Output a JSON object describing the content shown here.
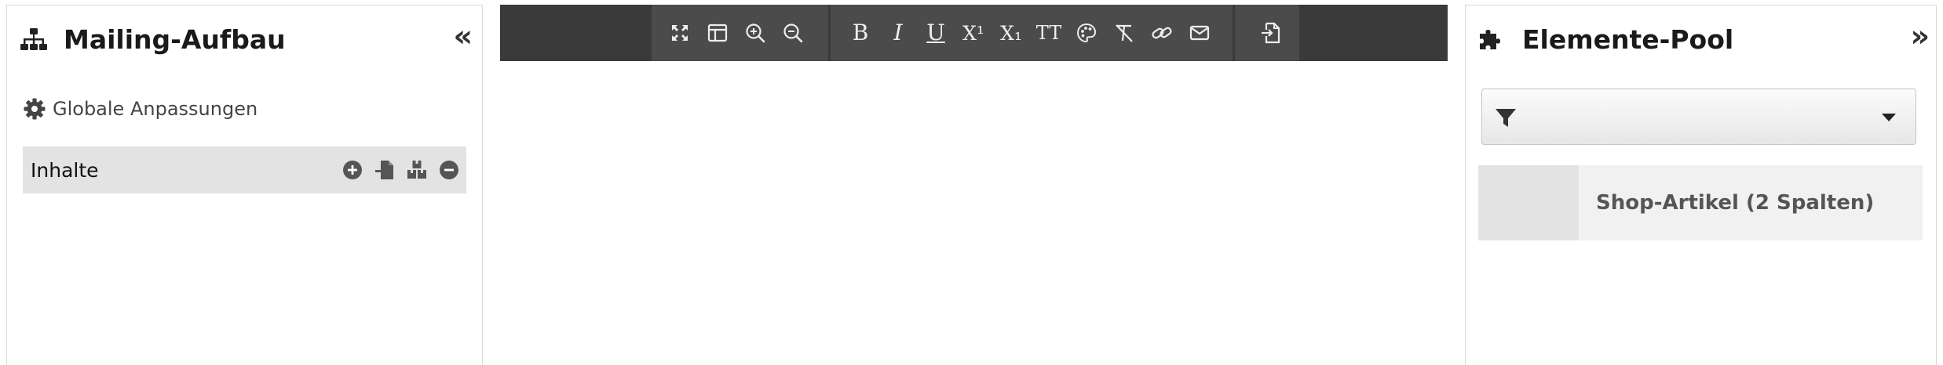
{
  "left_panel": {
    "title": "Mailing-Aufbau",
    "title_icon": "sitemap-icon",
    "collapse_glyph": "«",
    "global_settings_label": "Globale Anpassungen",
    "content_section_label": "Inhalte",
    "content_actions": [
      "plus-circle-icon",
      "import-file-icon",
      "boxes-icon",
      "minus-circle-icon"
    ]
  },
  "editor": {
    "toolbar_group1": [
      "fullscreen-icon",
      "layout-icon",
      "zoom-in-icon",
      "zoom-out-icon"
    ],
    "toolbar_group2": {
      "bold": "B",
      "italic": "I",
      "underline": "U",
      "superscript": "X¹",
      "subscript": "X₁",
      "font_size": "TT",
      "icons": [
        "palette-icon",
        "clear-format-icon",
        "link-icon",
        "envelope-icon"
      ]
    },
    "toolbar_group3": [
      "export-file-icon"
    ],
    "colors": {
      "toolbar_bg": "#3a3a3a",
      "group_bg": "#4b4b4b",
      "icon": "#eeeeee"
    }
  },
  "right_panel": {
    "title": "Elemente-Pool",
    "title_icon": "puzzle-icon",
    "collapse_glyph": "»",
    "filter": {
      "icon": "filter-icon",
      "value": ""
    },
    "pool_items": [
      {
        "label": "Shop-Artikel (2 Spalten)"
      }
    ]
  }
}
